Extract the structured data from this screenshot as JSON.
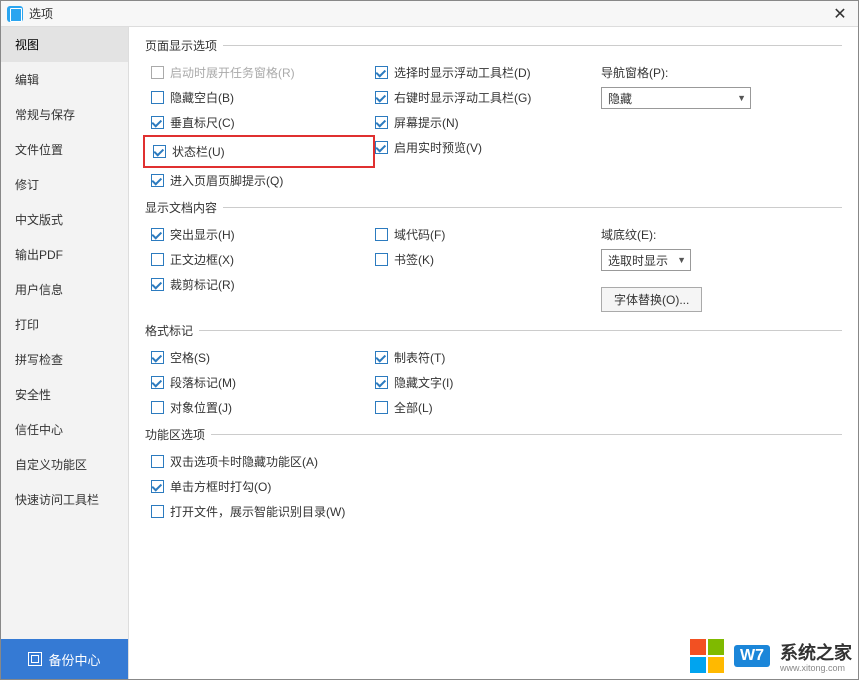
{
  "window": {
    "title": "选项"
  },
  "sidebar": {
    "items": [
      "视图",
      "编辑",
      "常规与保存",
      "文件位置",
      "修订",
      "中文版式",
      "输出PDF",
      "用户信息",
      "打印",
      "拼写检查",
      "安全性",
      "信任中心",
      "自定义功能区",
      "快速访问工具栏"
    ],
    "backup": "备份中心"
  },
  "groups": {
    "page": {
      "legend": "页面显示选项",
      "col1": {
        "expandTaskPane": "启动时展开任务窗格(R)",
        "hideBlank": "隐藏空白(B)",
        "vRuler": "垂直标尺(C)",
        "statusBar": "状态栏(U)",
        "enterHeaderFooter": "进入页眉页脚提示(Q)"
      },
      "col2": {
        "showFloatToolSel": "选择时显示浮动工具栏(D)",
        "showFloatToolRight": "右键时显示浮动工具栏(G)",
        "screenTip": "屏幕提示(N)",
        "livePreview": "启用实时预览(V)"
      },
      "col3": {
        "navPaneLabel": "导航窗格(P):",
        "navPaneValue": "隐藏"
      }
    },
    "doc": {
      "legend": "显示文档内容",
      "col1": {
        "highlight": "突出显示(H)",
        "textBoundary": "正文边框(X)",
        "cropMarks": "裁剪标记(R)"
      },
      "col2": {
        "fieldCodes": "域代码(F)",
        "bookmarks": "书签(K)"
      },
      "col3": {
        "fieldShadingLabel": "域底纹(E):",
        "fieldShadingValue": "选取时显示",
        "fontSub": "字体替换(O)..."
      }
    },
    "marks": {
      "legend": "格式标记",
      "col1": {
        "spaces": "空格(S)",
        "paraMarks": "段落标记(M)",
        "objAnchors": "对象位置(J)"
      },
      "col2": {
        "tabChars": "制表符(T)",
        "hiddenText": "隐藏文字(I)",
        "all": "全部(L)"
      }
    },
    "ribbon": {
      "legend": "功能区选项",
      "dblClickHide": "双击选项卡时隐藏功能区(A)",
      "singleClickCheck": "单击方框时打勾(O)",
      "openFileSmartDir": "打开文件，展示智能识别目录(W)"
    }
  },
  "watermark": {
    "badge": "W7",
    "text": "系统之家",
    "sub": "www.xitong.com"
  }
}
